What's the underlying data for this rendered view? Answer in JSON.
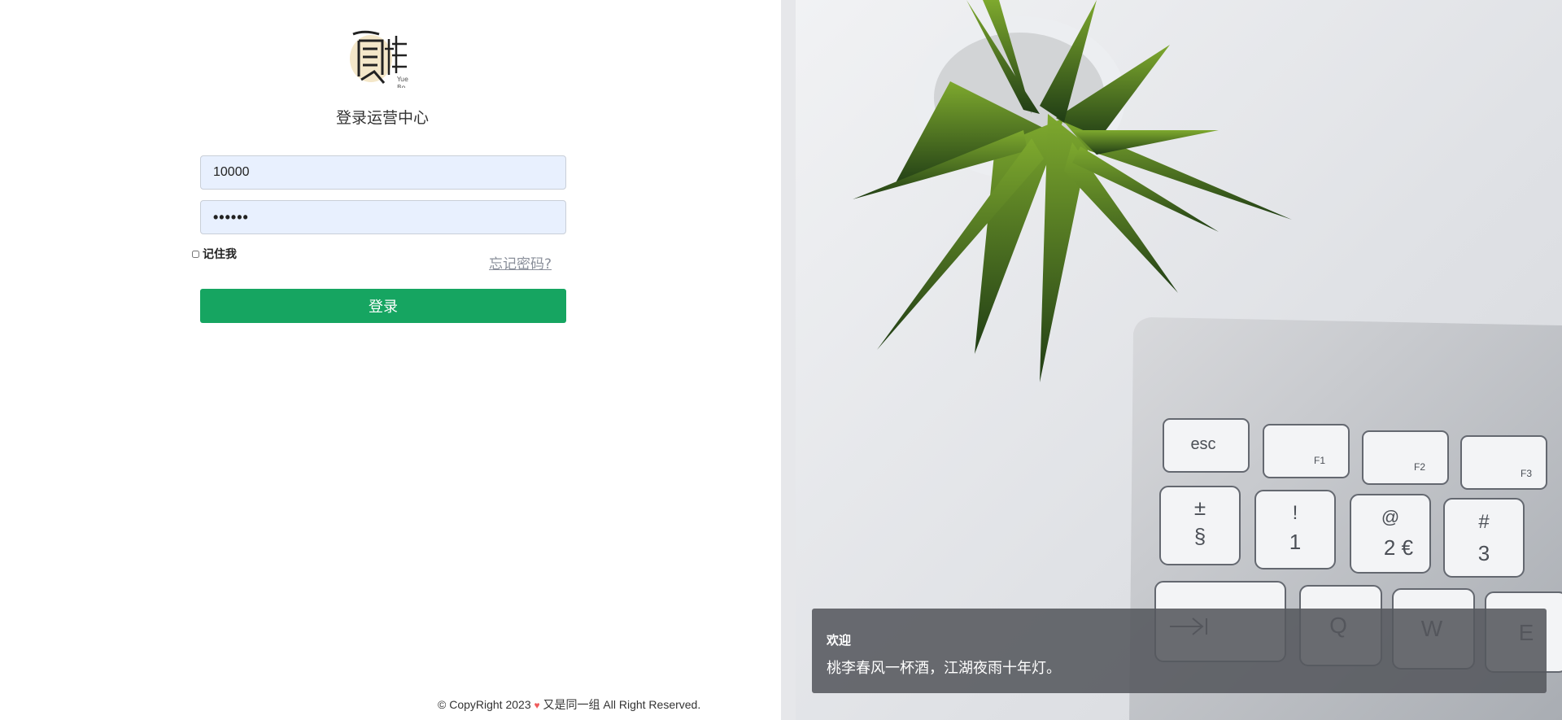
{
  "login": {
    "logo_label": "Yue Bo",
    "title": "登录运营中心",
    "username_value": "10000",
    "password_value": "••••••",
    "remember_label": "记住我",
    "forgot_label": "忘记密码?",
    "submit_label": "登录"
  },
  "footer": {
    "prefix": "© CopyRight 2023",
    "heart": "♥",
    "suffix": "又是同一组 All Right Reserved."
  },
  "banner": {
    "caption_title": "欢迎",
    "caption_text": "桃李春风一杯酒，江湖夜雨十年灯。",
    "keys": [
      "esc",
      "F1",
      "F2",
      "F3",
      "±",
      "§",
      "!",
      "1",
      "@",
      "2 €",
      "#",
      "3",
      "Q",
      "W",
      "E"
    ]
  },
  "colors": {
    "primary": "#16a561",
    "field_bg": "#e8f0fe",
    "caption_bg": "#55585d"
  }
}
